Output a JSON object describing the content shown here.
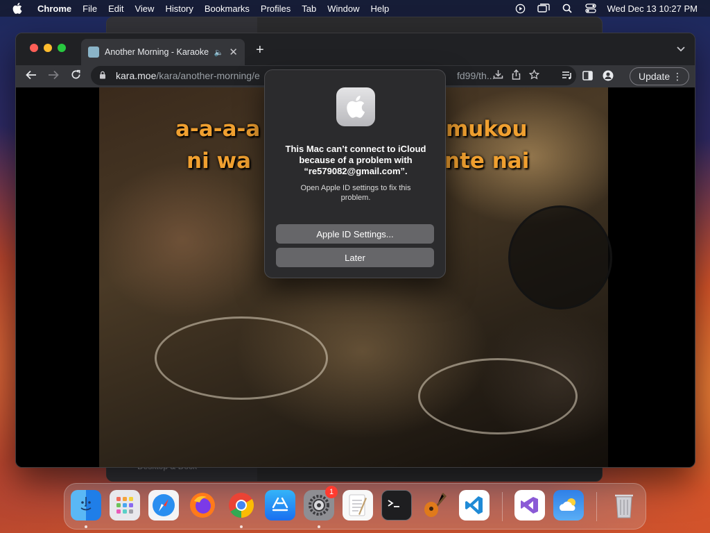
{
  "menubar": {
    "app_name": "Chrome",
    "items": [
      "File",
      "Edit",
      "View",
      "History",
      "Bookmarks",
      "Profiles",
      "Tab",
      "Window",
      "Help"
    ],
    "status_icons": [
      "play-circle-icon",
      "screens-icon",
      "search-icon",
      "control-center-icon"
    ],
    "clock": "Wed Dec 13  10:27 PM"
  },
  "background_window": {
    "sidebar_item": "Desktop & Dock"
  },
  "browser": {
    "tab": {
      "title": "Another Morning - Karaoke",
      "audio_icon": "speaker-icon"
    },
    "url": {
      "host": "kara.moe",
      "path": "/kara/another-morning/e",
      "path_tail": "fd99/th..."
    },
    "update_label": "Update"
  },
  "video": {
    "lyric_line1_left": "a-a-a-a",
    "lyric_line1_right": "mukou",
    "lyric_line2_left": "ni wa",
    "lyric_line2_right": "nte nai"
  },
  "alert": {
    "title": "This Mac can’t connect to iCloud because of a problem with “re579082@gmail.com”.",
    "message": "Open Apple ID settings to fix this problem.",
    "primary_button": "Apple ID Settings...",
    "secondary_button": "Later"
  },
  "dock": {
    "apps": [
      "Finder",
      "Launchpad",
      "Safari",
      "Firefox",
      "Chrome",
      "App Store",
      "System Settings",
      "TextEdit",
      "Terminal",
      "GarageBand",
      "Visual Studio Code",
      "Visual Studio",
      "Weather",
      "Trash"
    ],
    "settings_badge": "1"
  },
  "colors": {
    "lyric": "#f0a030",
    "close": "#ff5f57",
    "minimize": "#febc2e",
    "maximize": "#28c840",
    "badge": "#ff3b30"
  }
}
